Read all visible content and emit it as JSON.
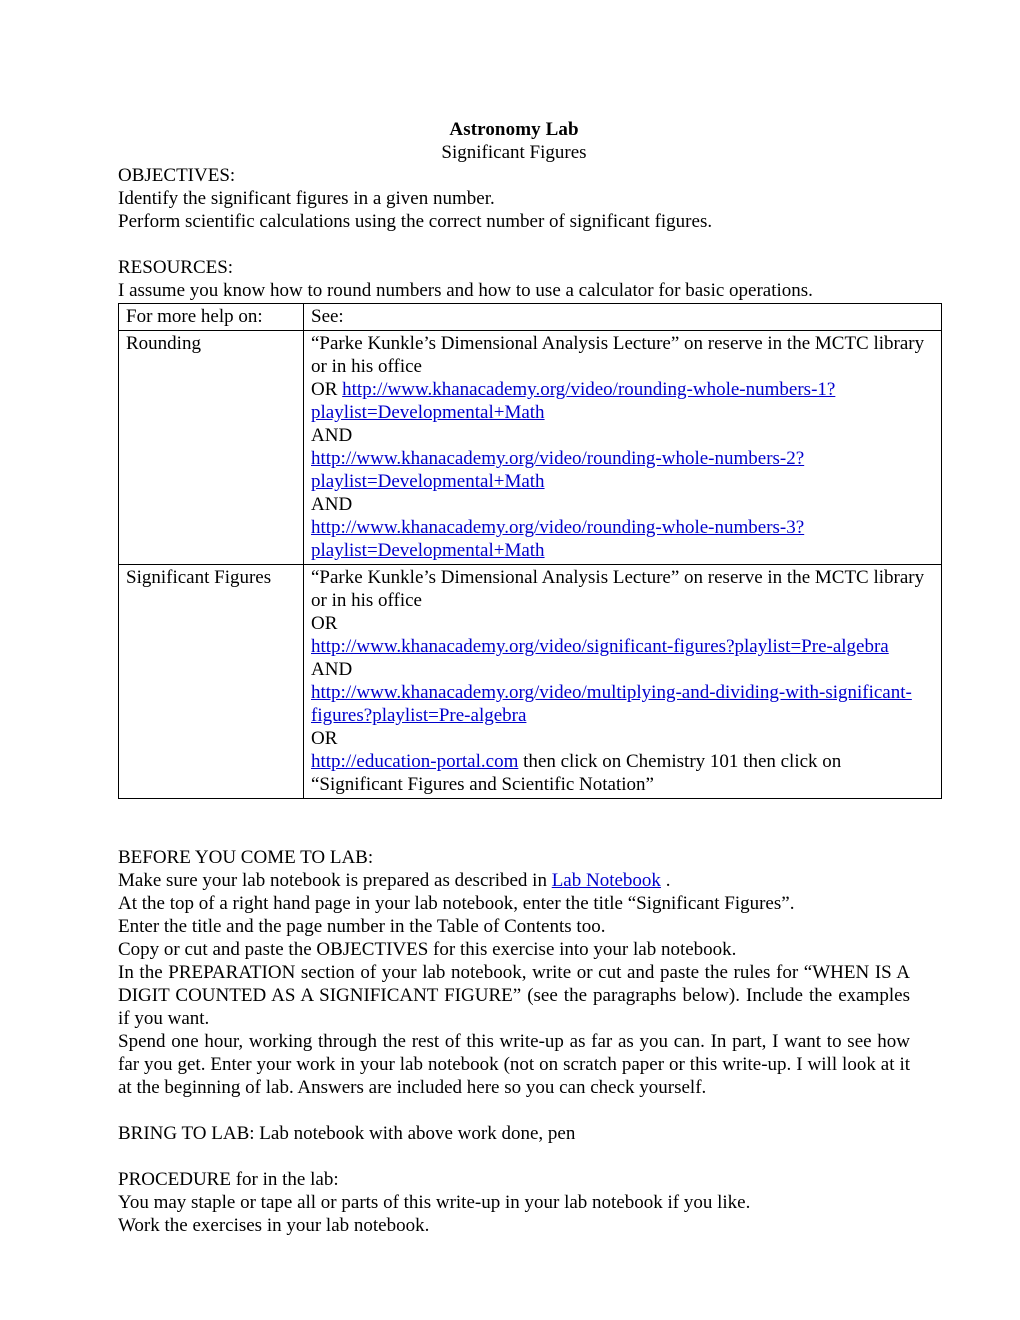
{
  "document": {
    "title": "Astronomy Lab",
    "subtitle": "Significant Figures",
    "objectives": {
      "heading": "OBJECTIVES:",
      "items": [
        "Identify the significant figures in a given number.",
        "Perform scientific calculations using the correct number of significant figures."
      ]
    },
    "resources": {
      "heading": "RESOURCES:",
      "intro": "I assume you know how to round numbers and how to use a calculator for basic operations.",
      "table": {
        "headers": [
          "For more help on:",
          "See:"
        ],
        "rows": [
          {
            "topic": "Rounding",
            "lines": [
              {
                "text": "“Parke Kunkle’s Dimensional Analysis Lecture” on reserve in the MCTC library or in his office",
                "type": "text"
              },
              {
                "prefix": "OR ",
                "text": "http://www.khanacademy.org/video/rounding-whole-numbers-1?playlist=Developmental+Math",
                "type": "link"
              },
              {
                "text": "AND",
                "type": "text"
              },
              {
                "text": "http://www.khanacademy.org/video/rounding-whole-numbers-2?playlist=Developmental+Math",
                "type": "link"
              },
              {
                "text": "AND",
                "type": "text"
              },
              {
                "text": "http://www.khanacademy.org/video/rounding-whole-numbers-3?playlist=Developmental+Math",
                "type": "link"
              }
            ]
          },
          {
            "topic": "Significant Figures",
            "lines": [
              {
                "text": "“Parke Kunkle’s Dimensional Analysis Lecture” on reserve in the MCTC library or in his office",
                "type": "text"
              },
              {
                "text": "OR",
                "type": "text"
              },
              {
                "text": "http://www.khanacademy.org/video/significant-figures?playlist=Pre-algebra",
                "type": "link"
              },
              {
                "text": "AND",
                "type": "text"
              },
              {
                "text": "http://www.khanacademy.org/video/multiplying-and-dividing-with-significant-figures?playlist=Pre-algebra",
                "type": "link"
              },
              {
                "text": "OR",
                "type": "text"
              },
              {
                "text": "http://education-portal.com",
                "suffix": " then click on Chemistry 101 then click on “Significant Figures and Scientific Notation”",
                "type": "link"
              }
            ]
          }
        ]
      }
    },
    "before_lab": {
      "heading": "BEFORE YOU COME TO LAB:",
      "line1_pre": "Make sure your lab notebook is prepared as described in ",
      "line1_link": "Lab Notebook",
      "line1_post": " .",
      "line2": "At the top of a right hand page in your lab notebook, enter the title “Significant Figures”.",
      "line3": "Enter the title and the page number in the Table of Contents too.",
      "line4": "Copy or cut and paste the OBJECTIVES for this exercise into your lab notebook.",
      "paragraph1": "In the PREPARATION section of your lab notebook, write or cut and paste the rules for “WHEN IS A DIGIT COUNTED AS A SIGNIFICANT FIGURE” (see the paragraphs below). Include the examples if you want.",
      "paragraph2": "Spend one hour, working through the rest of this write-up as far as you can. In part, I want to see how far you get. Enter your work in your lab notebook (not on scratch paper or this write-up. I will look at it at the beginning of lab. Answers are included here so you can check yourself."
    },
    "bring_to_lab": "BRING TO LAB: Lab notebook with above work done, pen",
    "procedure": {
      "heading": "PROCEDURE for in the lab:",
      "line1": "You may staple or tape all or parts of this write-up in your lab notebook if you like.",
      "line2": "Work the exercises in your lab notebook."
    },
    "colors": {
      "text": "#000000",
      "link": "#0000cc",
      "background": "#ffffff",
      "table_border": "#000000"
    }
  }
}
